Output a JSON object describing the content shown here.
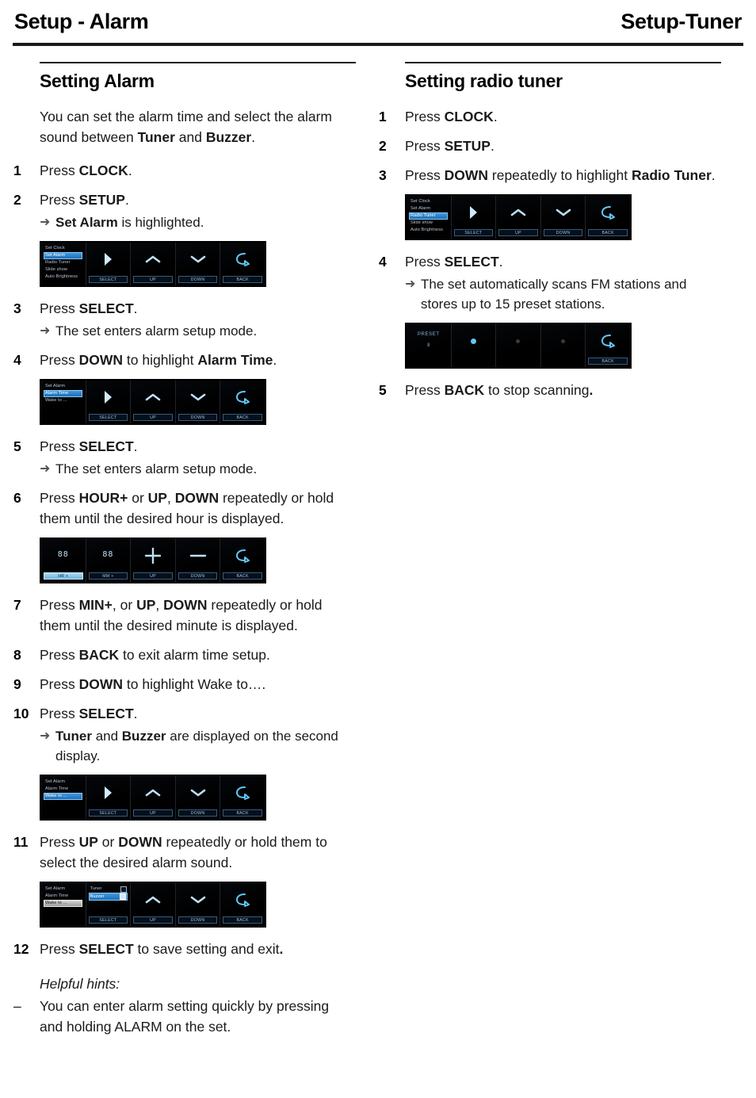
{
  "runhead": {
    "left": "Setup - Alarm",
    "right": "Setup-Tuner"
  },
  "left_column": {
    "section_title": "Setting Alarm",
    "intro": "You can set the alarm time and select the alarm sound between Tuner and Buzzer.",
    "steps": [
      {
        "num": "1",
        "text": "Press CLOCK."
      },
      {
        "num": "2",
        "text": "Press SETUP.",
        "result": "Set Alarm is highlighted."
      },
      {
        "num": "3",
        "text": "Press SELECT.",
        "result": "The set enters alarm setup mode."
      },
      {
        "num": "4",
        "text": "Press DOWN to highlight Alarm Time."
      },
      {
        "num": "5",
        "text": "Press SELECT.",
        "result": "The set enters alarm setup mode."
      },
      {
        "num": "6",
        "text": "Press HOUR+ or UP, DOWN repeatedly or hold them until the desired hour is displayed."
      },
      {
        "num": "7",
        "text": "Press MIN+, or UP, DOWN repeatedly or hold them until the desired minute is displayed."
      },
      {
        "num": "8",
        "text": "Press BACK to exit alarm time setup."
      },
      {
        "num": "9",
        "text": "Press DOWN to highlight Wake to…."
      },
      {
        "num": "10",
        "text": "Press SELECT.",
        "result": "Tuner and Buzzer are displayed on the second display."
      },
      {
        "num": "11",
        "text": "Press UP or DOWN repeatedly or hold them to select the desired alarm sound."
      },
      {
        "num": "12",
        "text": "Press SELECT to save setting and exit."
      }
    ],
    "hints_label": "Helpful hints:",
    "hints": [
      {
        "dash": "–",
        "text": "You can enter alarm setting quickly by pressing and holding ALARM on the set."
      }
    ]
  },
  "right_column": {
    "section_title": "Setting radio tuner",
    "steps": [
      {
        "num": "1",
        "text": "Press CLOCK."
      },
      {
        "num": "2",
        "text": "Press SETUP."
      },
      {
        "num": "3",
        "text": "Press DOWN repeatedly to highlight Radio Tuner."
      },
      {
        "num": "4",
        "text": "Press SELECT.",
        "result": "The set automatically scans FM stations and stores up to 15 preset stations."
      },
      {
        "num": "5",
        "text": "Press BACK to stop scanning."
      }
    ]
  },
  "device_screens": {
    "setup_menu_set_alarm": {
      "menu": [
        "Set Clock",
        "Set Alarm",
        "Radio Tuner",
        "Slide show",
        "Auto Brightness"
      ],
      "highlighted": "Set Alarm",
      "glyphs": [
        "play-right-icon",
        "chevron-up-icon",
        "chevron-down-icon",
        "back-arrow-icon"
      ],
      "softkeys": [
        "SELECT",
        "UP",
        "DOWN",
        "BACK"
      ]
    },
    "alarm_submenu_alarm_time": {
      "menu": [
        "Set Alarm",
        "Alarm Time",
        "Wake to ..."
      ],
      "highlighted": "Alarm Time",
      "glyphs": [
        "play-right-icon",
        "chevron-up-icon",
        "chevron-down-icon",
        "back-arrow-icon"
      ],
      "softkeys": [
        "SELECT",
        "UP",
        "DOWN",
        "BACK"
      ]
    },
    "alarm_time_editor": {
      "hour_value": "88",
      "minute_value": "88",
      "glyphs": [
        "plus-icon",
        "minus-icon",
        "back-arrow-icon"
      ],
      "softkeys": [
        "HR +",
        "MM +",
        "UP",
        "DOWN",
        "BACK"
      ],
      "highlighted_softkey": "HR +"
    },
    "alarm_submenu_wake_to": {
      "menu": [
        "Set Alarm",
        "Alarm Time",
        "Wake to ..."
      ],
      "highlighted": "Wake to ...",
      "glyphs": [
        "play-right-icon",
        "chevron-up-icon",
        "chevron-down-icon",
        "back-arrow-icon"
      ],
      "softkeys": [
        "SELECT",
        "UP",
        "DOWN",
        "BACK"
      ]
    },
    "wake_to_options": {
      "menu": [
        "Set Alarm",
        "Alarm Time",
        "Wake to ..."
      ],
      "menu_highlighted": "Wake to ...",
      "options": [
        "Tuner",
        "Buzzer"
      ],
      "option_highlighted": "Buzzer",
      "glyphs": [
        "chevron-up-icon",
        "chevron-down-icon",
        "back-arrow-icon"
      ],
      "softkeys": [
        "SELECT",
        "UP",
        "DOWN",
        "BACK"
      ]
    },
    "setup_menu_radio_tuner": {
      "menu": [
        "Set Clock",
        "Set Alarm",
        "Radio Tuner",
        "Slide show",
        "Auto Brightness"
      ],
      "highlighted": "Radio Tuner",
      "glyphs": [
        "play-right-icon",
        "chevron-up-icon",
        "chevron-down-icon",
        "back-arrow-icon"
      ],
      "softkeys": [
        "SELECT",
        "UP",
        "DOWN",
        "BACK"
      ]
    },
    "preset_scan": {
      "label": "PRESET",
      "value": "8",
      "glyphs": [
        "dot-active-icon",
        "dot-dim-icon",
        "dot-dim-icon",
        "back-arrow-icon"
      ],
      "softkeys": [
        "BACK"
      ]
    }
  },
  "colors": {
    "highlight_blue": "#2f86d0",
    "glyph_blue": "#9fd4f2",
    "screen_black": "#000000",
    "rule_black": "#1a1a1a"
  }
}
